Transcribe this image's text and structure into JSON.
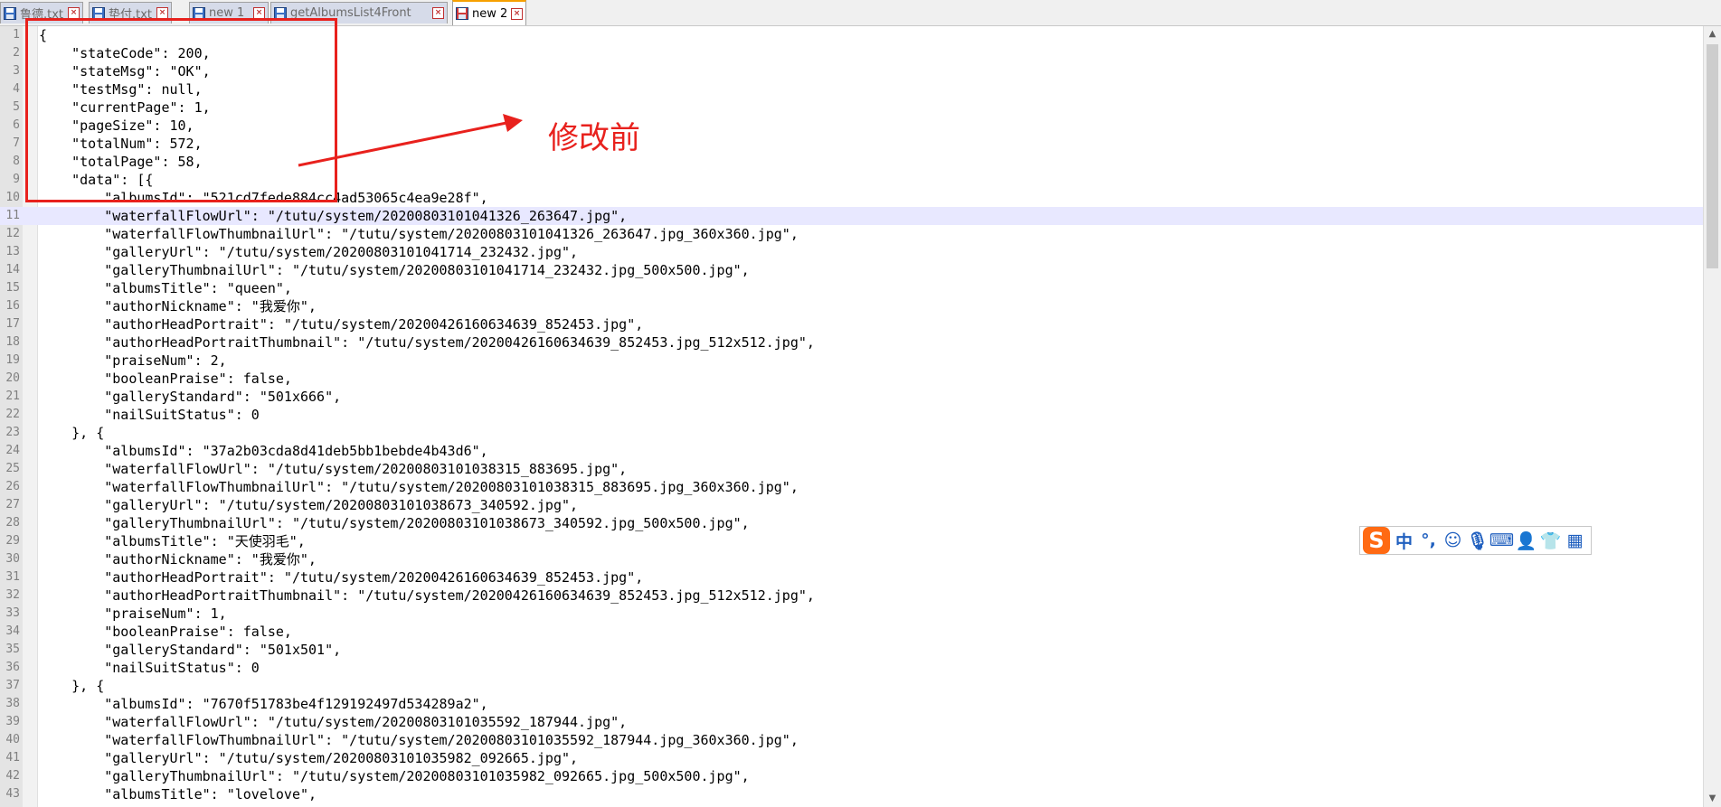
{
  "tabs": [
    {
      "label": "鲁德.txt",
      "icon": "floppy-disk-icon",
      "active": false
    },
    {
      "label": "垫付.txt",
      "icon": "floppy-disk-icon",
      "active": false
    },
    {
      "label": "new 1",
      "icon": "floppy-disk-icon",
      "active": false
    },
    {
      "label": "getAlbumsList4Front",
      "icon": "floppy-disk-icon",
      "active": false
    },
    {
      "label": "new 2",
      "icon": "floppy-disk-red-icon",
      "active": true
    }
  ],
  "editor": {
    "current_line": 11,
    "lines": [
      "{",
      "    \"stateCode\": 200,",
      "    \"stateMsg\": \"OK\",",
      "    \"testMsg\": null,",
      "    \"currentPage\": 1,",
      "    \"pageSize\": 10,",
      "    \"totalNum\": 572,",
      "    \"totalPage\": 58,",
      "    \"data\": [{",
      "        \"albumsId\": \"521cd7fede884cc4ad53065c4ea9e28f\",",
      "        \"waterfallFlowUrl\": \"/tutu/system/20200803101041326_263647.jpg\",",
      "        \"waterfallFlowThumbnailUrl\": \"/tutu/system/20200803101041326_263647.jpg_360x360.jpg\",",
      "        \"galleryUrl\": \"/tutu/system/20200803101041714_232432.jpg\",",
      "        \"galleryThumbnailUrl\": \"/tutu/system/20200803101041714_232432.jpg_500x500.jpg\",",
      "        \"albumsTitle\": \"queen\",",
      "        \"authorNickname\": \"我爱你\",",
      "        \"authorHeadPortrait\": \"/tutu/system/20200426160634639_852453.jpg\",",
      "        \"authorHeadPortraitThumbnail\": \"/tutu/system/20200426160634639_852453.jpg_512x512.jpg\",",
      "        \"praiseNum\": 2,",
      "        \"booleanPraise\": false,",
      "        \"galleryStandard\": \"501x666\",",
      "        \"nailSuitStatus\": 0",
      "    }, {",
      "        \"albumsId\": \"37a2b03cda8d41deb5bb1bebde4b43d6\",",
      "        \"waterfallFlowUrl\": \"/tutu/system/20200803101038315_883695.jpg\",",
      "        \"waterfallFlowThumbnailUrl\": \"/tutu/system/20200803101038315_883695.jpg_360x360.jpg\",",
      "        \"galleryUrl\": \"/tutu/system/20200803101038673_340592.jpg\",",
      "        \"galleryThumbnailUrl\": \"/tutu/system/20200803101038673_340592.jpg_500x500.jpg\",",
      "        \"albumsTitle\": \"天使羽毛\",",
      "        \"authorNickname\": \"我爱你\",",
      "        \"authorHeadPortrait\": \"/tutu/system/20200426160634639_852453.jpg\",",
      "        \"authorHeadPortraitThumbnail\": \"/tutu/system/20200426160634639_852453.jpg_512x512.jpg\",",
      "        \"praiseNum\": 1,",
      "        \"booleanPraise\": false,",
      "        \"galleryStandard\": \"501x501\",",
      "        \"nailSuitStatus\": 0",
      "    }, {",
      "        \"albumsId\": \"7670f51783be4f129192497d534289a2\",",
      "        \"waterfallFlowUrl\": \"/tutu/system/20200803101035592_187944.jpg\",",
      "        \"waterfallFlowThumbnailUrl\": \"/tutu/system/20200803101035592_187944.jpg_360x360.jpg\",",
      "        \"galleryUrl\": \"/tutu/system/20200803101035982_092665.jpg\",",
      "        \"galleryThumbnailUrl\": \"/tutu/system/20200803101035982_092665.jpg_500x500.jpg\",",
      "        \"albumsTitle\": \"lovelove\","
    ]
  },
  "annotation": {
    "text": "修改前",
    "color": "#e8211d"
  },
  "ime_toolbar": {
    "logo": "S",
    "items": [
      {
        "icon": "chinese-mode-icon",
        "glyph": "中"
      },
      {
        "icon": "punctuation-icon",
        "glyph": "°,"
      },
      {
        "icon": "emoji-icon",
        "glyph": "☺"
      },
      {
        "icon": "microphone-icon",
        "glyph": "🎙"
      },
      {
        "icon": "keyboard-icon",
        "glyph": "⌨"
      },
      {
        "icon": "user-icon",
        "glyph": "👤"
      },
      {
        "icon": "shirt-icon",
        "glyph": "👕"
      },
      {
        "icon": "grid-icon",
        "glyph": "▦"
      }
    ]
  }
}
